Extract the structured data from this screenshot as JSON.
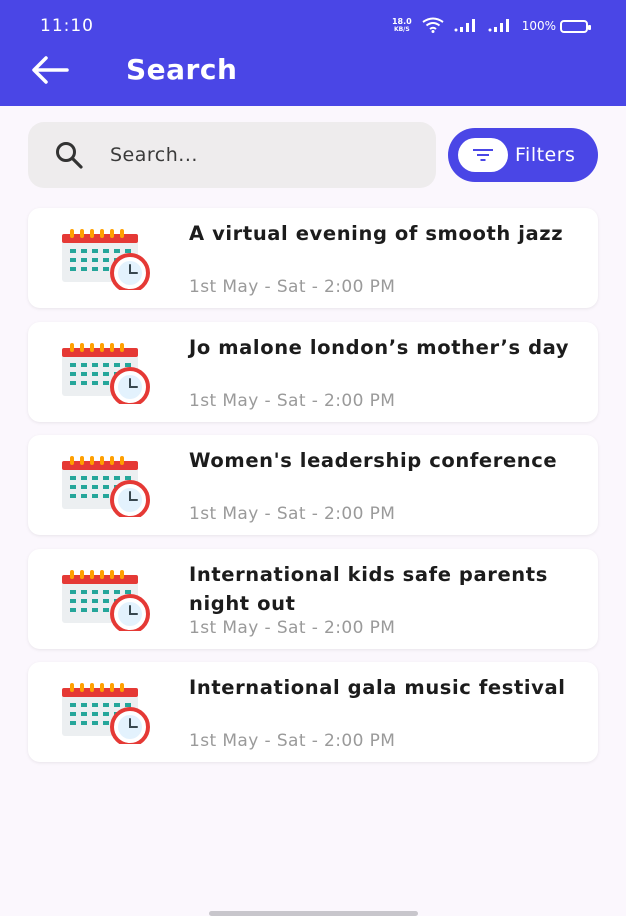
{
  "status_bar": {
    "time": "11:10",
    "net_speed_value": "18.0",
    "net_speed_unit": "KB/S",
    "battery_percent": "100%"
  },
  "header": {
    "title": "Search",
    "back_icon": "arrow-left-icon"
  },
  "search": {
    "placeholder": "Search...",
    "icon": "search-icon"
  },
  "filters": {
    "label": "Filters",
    "icon": "filter-icon"
  },
  "events": [
    {
      "title": "A virtual evening of smooth jazz",
      "date": "1st May - Sat - 2:00 PM",
      "icon": "calendar-clock-icon"
    },
    {
      "title": "Jo malone london’s mother’s day",
      "date": "1st May - Sat - 2:00 PM",
      "icon": "calendar-clock-icon"
    },
    {
      "title": "Women's leadership conference",
      "date": "1st May - Sat - 2:00 PM",
      "icon": "calendar-clock-icon"
    },
    {
      "title": "International kids safe parents night out",
      "date": "1st May - Sat - 2:00 PM",
      "icon": "calendar-clock-icon"
    },
    {
      "title": "International gala music festival",
      "date": "1st May - Sat - 2:00 PM",
      "icon": "calendar-clock-icon"
    }
  ],
  "colors": {
    "primary": "#4a46e6",
    "background": "#fbf7fd",
    "search_bg": "#eeeced",
    "calendar_red": "#e53935",
    "calendar_teal": "#26a69a"
  }
}
